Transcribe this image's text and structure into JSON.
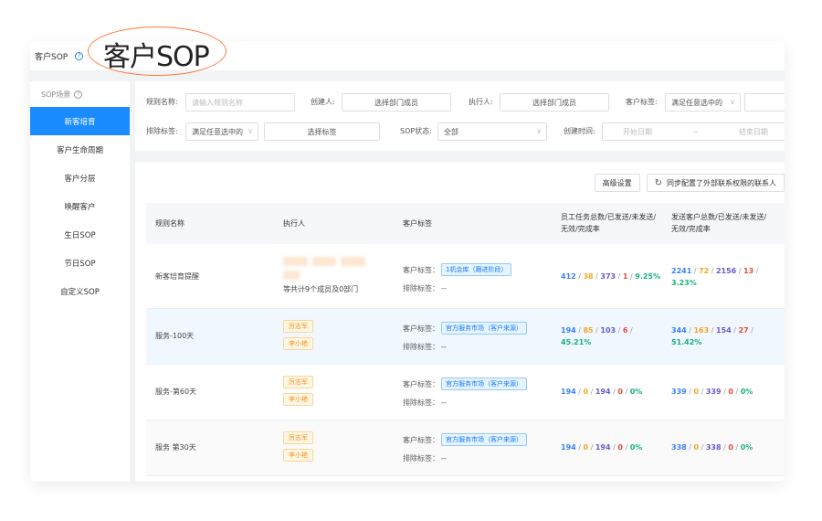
{
  "callout": "客户SOP",
  "header": {
    "title": "客户SOP"
  },
  "sidebar": {
    "header": "SOP场景",
    "items": [
      "新客培育",
      "客户生命周期",
      "客户分层",
      "唤醒客户",
      "生日SOP",
      "节日SOP",
      "自定义SOP"
    ]
  },
  "filters": {
    "rule_name_label": "规则名称:",
    "rule_name_placeholder": "请输入规则名称",
    "creator_label": "创建人:",
    "creator_value": "选择部门成员",
    "executor_label": "执行人:",
    "executor_value": "选择部门成员",
    "tag_label": "客户标签:",
    "tag_mode": "满足任意选中的",
    "exclude_label": "排除标签:",
    "exclude_mode": "满足任意选中的",
    "exclude_value": "选择标签",
    "status_label": "SOP状态:",
    "status_value": "全部",
    "created_label": "创建时间:",
    "start_placeholder": "开始日期",
    "range_sep": "~",
    "end_placeholder": "结束日期"
  },
  "actions": {
    "advanced": "高级设置",
    "sync": "同步配置了外部联系权限的联系人"
  },
  "table": {
    "headers": {
      "name": "规则名称",
      "executor": "执行人",
      "tags": "客户标签",
      "staff_stats": "员工任务总数/已发送/未发送/无效/完成率",
      "customer_stats": "发送客户总数/已发送/未发送/无效/完成率"
    },
    "tag_label": "客户标签：",
    "exclude_label": "排除标签：",
    "exclude_value": "--",
    "rows": [
      {
        "name": "新客培育提醒",
        "executors_note": "等共计9个成员及0部门",
        "tag": "1机会库（跟进阶段）",
        "staff": {
          "total": "412",
          "sent": "38",
          "unsent": "373",
          "invalid": "1",
          "rate": "9.25%"
        },
        "cust": {
          "total": "2241",
          "sent": "72",
          "unsent": "2156",
          "invalid": "13",
          "rate": "3.23%"
        }
      },
      {
        "name": "服务-100天",
        "executors": [
          "厉志军",
          "李小艳"
        ],
        "tag": "官方服务市场（客户来源）",
        "staff": {
          "total": "194",
          "sent": "85",
          "unsent": "103",
          "invalid": "6",
          "rate": "45.21%"
        },
        "cust": {
          "total": "344",
          "sent": "163",
          "unsent": "154",
          "invalid": "27",
          "rate": "51.42%"
        }
      },
      {
        "name": "服务-第60天",
        "executors": [
          "厉志军",
          "李小艳"
        ],
        "tag": "官方服务市场（客户来源）",
        "staff": {
          "total": "194",
          "sent": "0",
          "unsent": "194",
          "invalid": "0",
          "rate": "0%"
        },
        "cust": {
          "total": "339",
          "sent": "0",
          "unsent": "339",
          "invalid": "0",
          "rate": "0%"
        }
      },
      {
        "name": "服务 第30天",
        "executors": [
          "厉志军",
          "李小艳"
        ],
        "tag": "官方服务市场（客户来源）",
        "staff": {
          "total": "194",
          "sent": "0",
          "unsent": "194",
          "invalid": "0",
          "rate": "0%"
        },
        "cust": {
          "total": "338",
          "sent": "0",
          "unsent": "338",
          "invalid": "0",
          "rate": "0%"
        }
      }
    ]
  }
}
